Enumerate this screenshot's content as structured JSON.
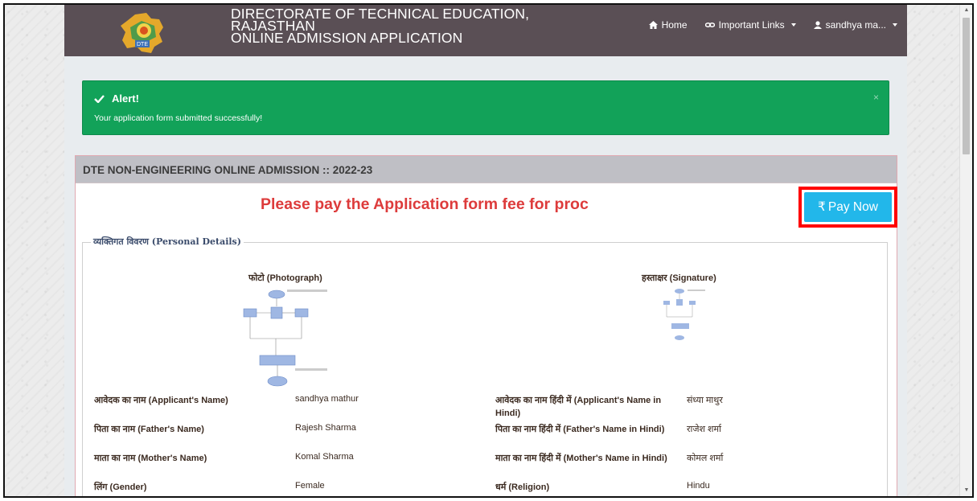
{
  "header": {
    "title_lines": [
      "DIRECTORATE OF TECHNICAL EDUCATION,",
      "RAJASTHAN",
      "ONLINE ADMISSION APPLICATION"
    ],
    "logo_icon": "rajasthan-map-logo",
    "nav": {
      "home": "Home",
      "links": "Important Links",
      "user": "sandhya ma..."
    }
  },
  "alert": {
    "title": "Alert!",
    "message": "Your application form submitted successfully!",
    "close": "×",
    "color": "#12a259"
  },
  "panel": {
    "heading": "DTE NON-ENGINEERING ONLINE ADMISSION :: 2022-23",
    "pay_message": "Please pay the Application form fee for proc",
    "pay_button": "Pay Now",
    "pay_currency": "₹",
    "accent": "#22b7ea"
  },
  "personal": {
    "legend": "व्यक्तिगत विवरण (Personal Details)",
    "photo_label": "फोटो (Photograph)",
    "signature_label": "हस्ताक्षर (Signature)",
    "rows": [
      {
        "label1": "आवेदक का नाम (Applicant's Name)",
        "value1": "sandhya mathur",
        "label2": "आवेदक का नाम हिंदी में (Applicant's Name in Hindi)",
        "value2": "संध्या माथुर"
      },
      {
        "label1": "पिता का नाम (Father's Name)",
        "value1": "Rajesh Sharma",
        "label2": "पिता का नाम हिंदी में (Father's Name in Hindi)",
        "value2": "राजेश शर्मा"
      },
      {
        "label1": "माता का नाम (Mother's Name)",
        "value1": "Komal Sharma",
        "label2": "माता का नाम हिंदी में (Mother's Name in Hindi)",
        "value2": "कोमल शर्मा"
      },
      {
        "label1": "लिंग (Gender)",
        "value1": "Female",
        "label2": "धर्म (Religion)",
        "value2": "Hindu"
      }
    ]
  }
}
